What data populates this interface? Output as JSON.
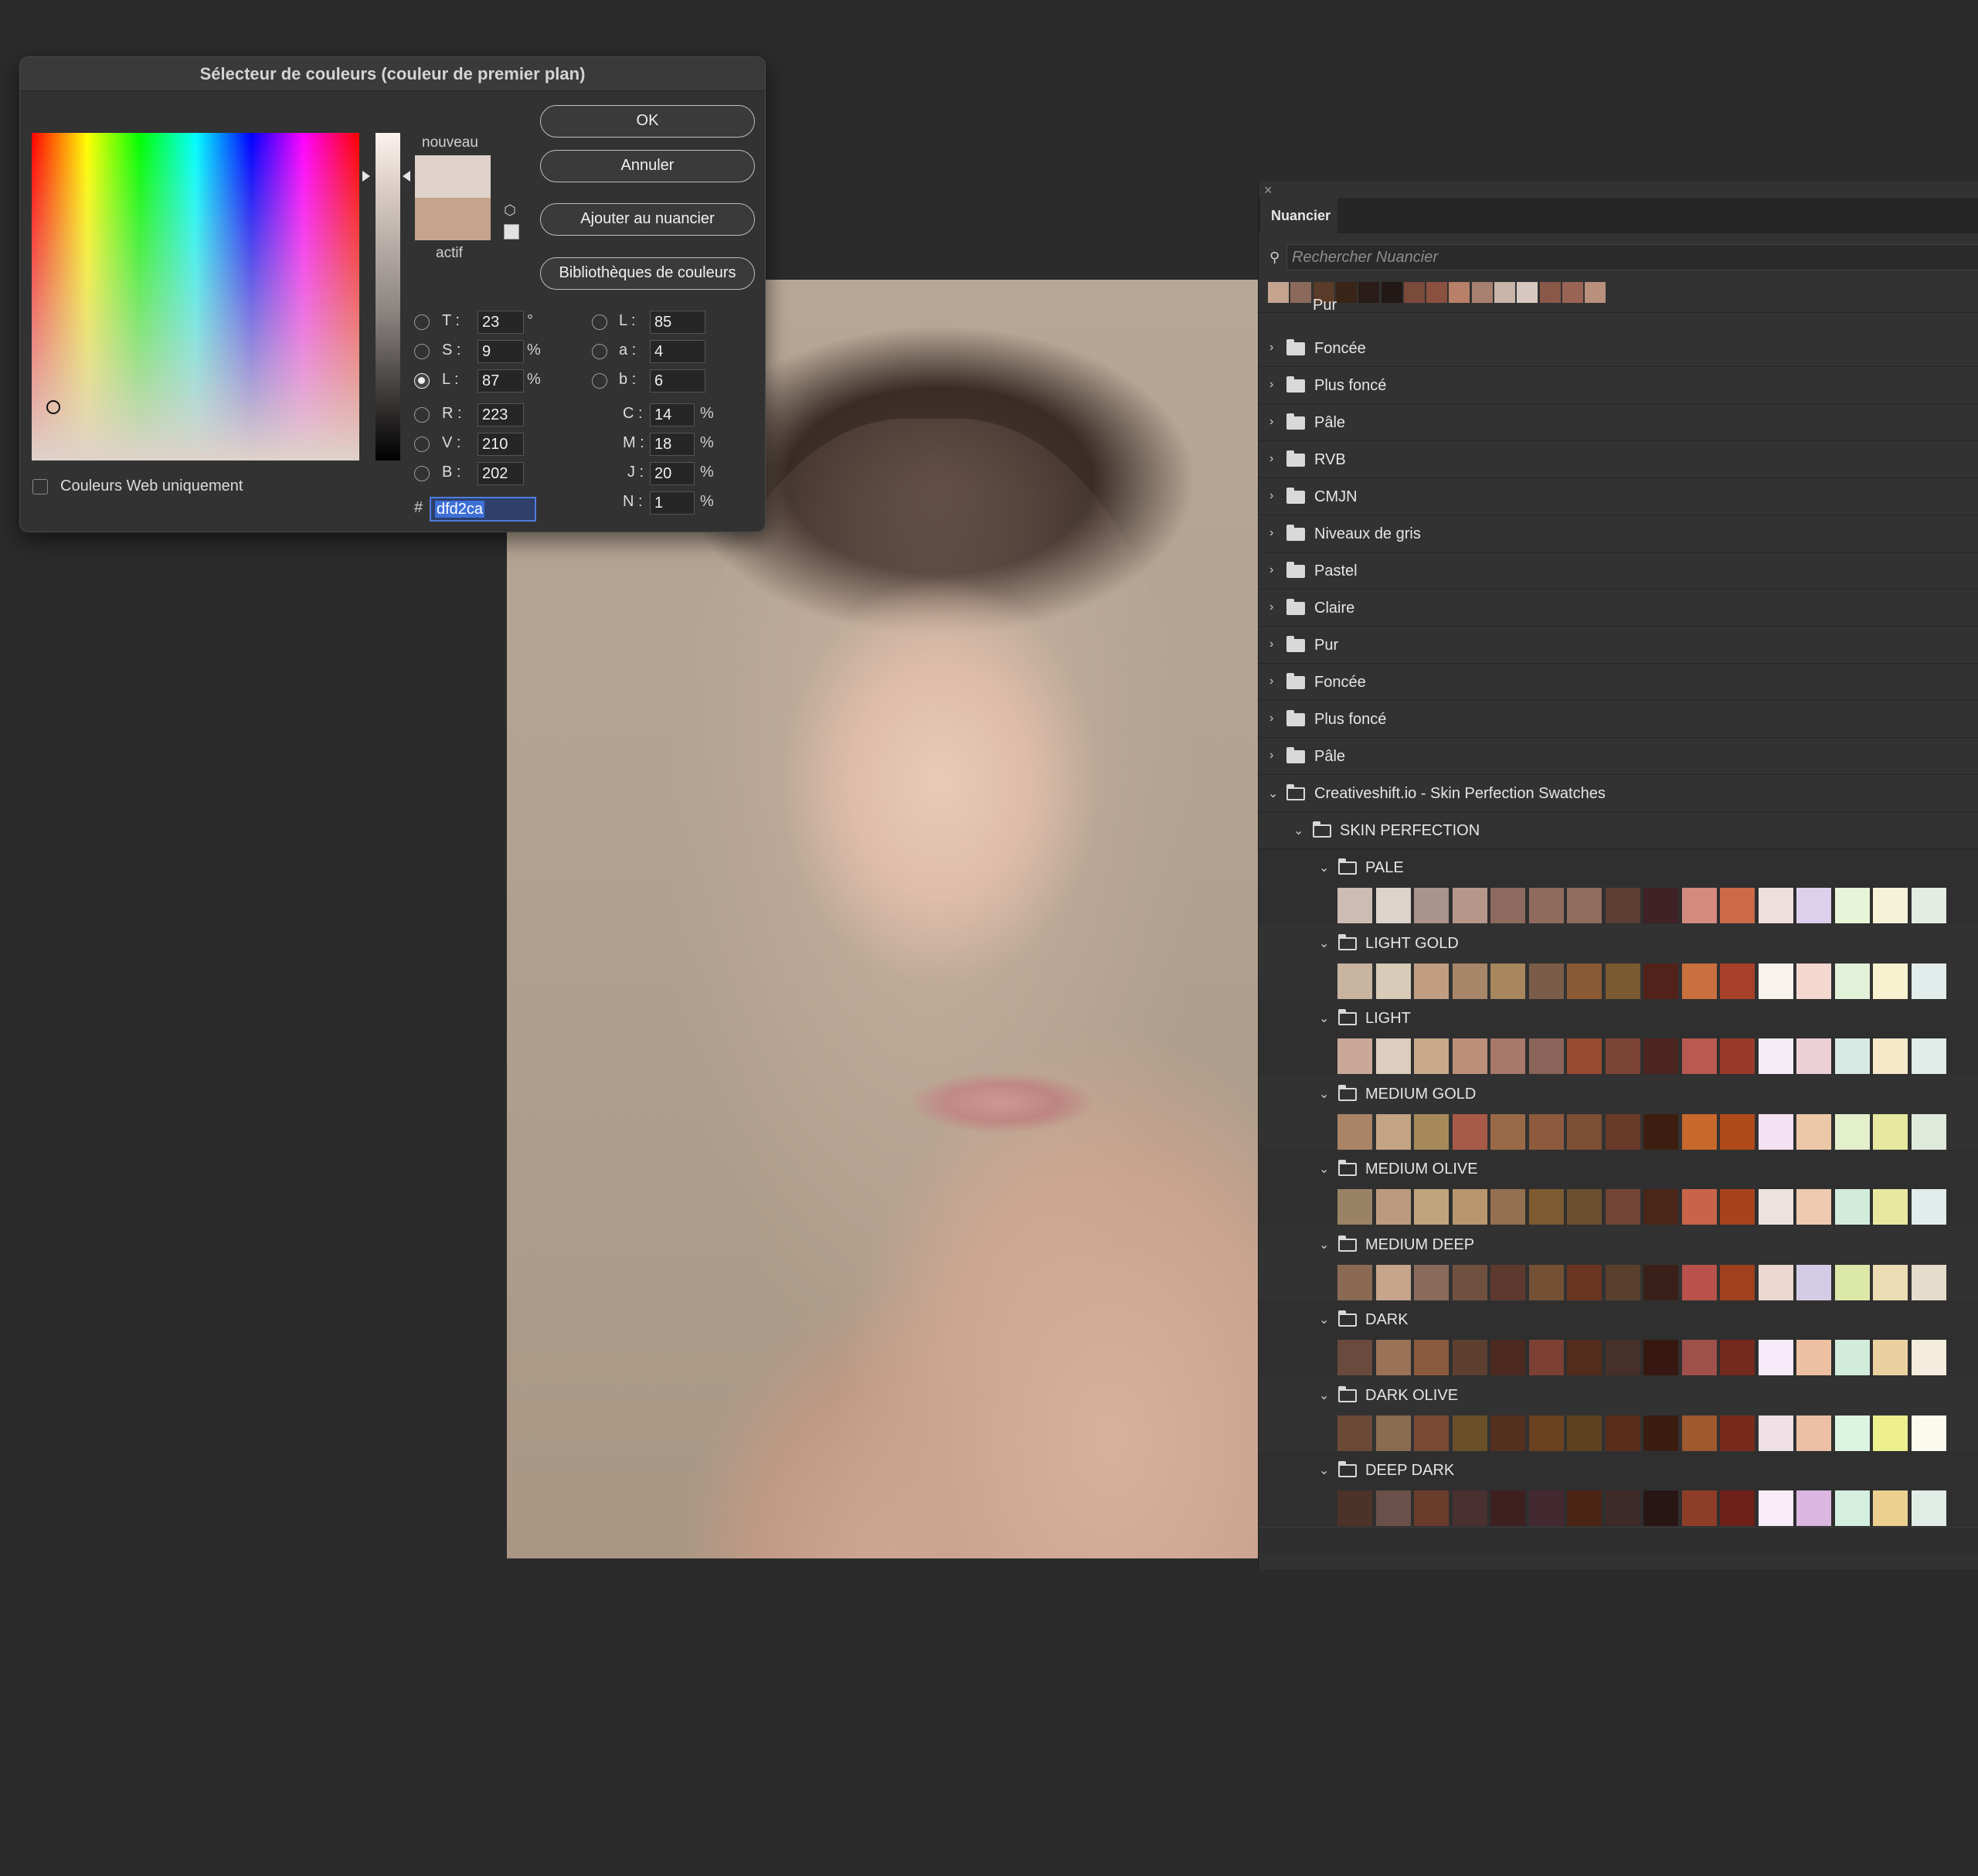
{
  "dialog": {
    "title": "Sélecteur de couleurs (couleur de premier plan)",
    "new_label": "nouveau",
    "current_label": "actif",
    "new_color": "#dfd2ca",
    "current_color": "#c4a48f",
    "buttons": {
      "ok": "OK",
      "cancel": "Annuler",
      "add_to_swatches": "Ajouter au nuancier",
      "color_libraries": "Bibliothèques de couleurs"
    },
    "web_colors_only": "Couleurs Web uniquement",
    "fields": {
      "H": {
        "label": "T :",
        "value": "23",
        "unit": "°"
      },
      "S": {
        "label": "S :",
        "value": "9",
        "unit": "%"
      },
      "Bv": {
        "label": "L :",
        "value": "87",
        "unit": "%"
      },
      "R": {
        "label": "R :",
        "value": "223"
      },
      "G": {
        "label": "V :",
        "value": "210"
      },
      "B": {
        "label": "B :",
        "value": "202"
      },
      "Lab_L": {
        "label": "L :",
        "value": "85"
      },
      "Lab_a": {
        "label": "a :",
        "value": "4"
      },
      "Lab_b": {
        "label": "b :",
        "value": "6"
      },
      "C": {
        "label": "C :",
        "value": "14",
        "unit": "%"
      },
      "M": {
        "label": "M :",
        "value": "18",
        "unit": "%"
      },
      "Y": {
        "label": "J :",
        "value": "20",
        "unit": "%"
      },
      "K": {
        "label": "N :",
        "value": "1",
        "unit": "%"
      },
      "hex_label": "#",
      "hex": "dfd2ca"
    },
    "selected_mode": "Bv"
  },
  "panel": {
    "close_glyph": "×",
    "tab": "Nuancier",
    "search_placeholder": "Rechercher Nuancier",
    "recent_colors": [
      "#c4a48f",
      "#8b6a5c",
      "#5a3a28",
      "#3a2418",
      "#2a1c18",
      "#221816",
      "#7a4a3a",
      "#8a5040",
      "#b88068",
      "#a88070",
      "#c8b4a8",
      "#d6c8c0",
      "#8a5848",
      "#9a6454",
      "#b8907c"
    ],
    "cut_item": "Pur",
    "folders": [
      "Foncée",
      "Plus foncé",
      "Pâle",
      "RVB",
      "CMJN",
      "Niveaux de gris",
      "Pastel",
      "Claire",
      "Pur",
      "Foncée",
      "Plus foncé",
      "Pâle"
    ],
    "library": "Creativeshift.io - Skin Perfection Swatches",
    "subfolder": "SKIN PERFECTION",
    "groups": [
      {
        "name": "PALE",
        "colors": [
          "#cdbcb3",
          "#dcd4ca",
          "#a9938a",
          "#b5978a",
          "#8c6a5e",
          "#8f6b5e",
          "#906c5e",
          "#5c3e33",
          "#3f2126",
          "#d58a80",
          "#cc6a48",
          "#ede0dc",
          "#ddd0ec",
          "#e8f4d8",
          "#f6f2d8",
          "#e4ece4"
        ]
      },
      {
        "name": "LIGHT GOLD",
        "colors": [
          "#c9b4a0",
          "#d8cbb8",
          "#c19e82",
          "#a88669",
          "#a8865e",
          "#7a5c48",
          "#8a5a34",
          "#7a5a30",
          "#52221a",
          "#c8703e",
          "#a8402a",
          "#f8f2ec",
          "#f4d8d0",
          "#e2f2d8",
          "#f8f2d0",
          "#e2ecea"
        ]
      },
      {
        "name": "LIGHT",
        "colors": [
          "#c9a89a",
          "#dccdbe",
          "#c8aa8a",
          "#bd907a",
          "#a8786a",
          "#8a6458",
          "#984a30",
          "#7c4434",
          "#4c2420",
          "#b85a52",
          "#9a3a2a",
          "#f6ecf8",
          "#ecd0d6",
          "#d8eae4",
          "#f6e8c8",
          "#e2ece8"
        ]
      },
      {
        "name": "MEDIUM GOLD",
        "colors": [
          "#a98466",
          "#c4a485",
          "#a88a5a",
          "#a85a48",
          "#9a6a48",
          "#8e5a3e",
          "#7c4e34",
          "#6a3a28",
          "#3e1e10",
          "#c8682c",
          "#b04a1a",
          "#f4e2f4",
          "#ecc8a8",
          "#e4f0cc",
          "#e8e8a0",
          "#e0eadc"
        ]
      },
      {
        "name": "MEDIUM OLIVE",
        "colors": [
          "#9a8266",
          "#bc9a80",
          "#c0a47c",
          "#b8966e",
          "#947050",
          "#7e5a30",
          "#6a5030",
          "#724436",
          "#4a2618",
          "#c8644a",
          "#a8421e",
          "#ede2e0",
          "#eecab0",
          "#d2ecdc",
          "#e8e8a0",
          "#e2ecea"
        ]
      },
      {
        "name": "MEDIUM DEEP",
        "colors": [
          "#8a6a52",
          "#c6a58c",
          "#8a6a5a",
          "#70503e",
          "#5e3a2e",
          "#745034",
          "#6a3420",
          "#5a3e2c",
          "#3a2018",
          "#b8524a",
          "#a0401e",
          "#ecd8d0",
          "#d4cce6",
          "#dce8a8",
          "#ecdcb4",
          "#e6dccc"
        ]
      },
      {
        "name": "DARK",
        "colors": [
          "#6a4a3c",
          "#9a7258",
          "#8a5a3e",
          "#5e4030",
          "#4c2a20",
          "#7c4034",
          "#542c1c",
          "#48302a",
          "#361810",
          "#a0504a",
          "#742a1c",
          "#f6eaf8",
          "#ecc0a0",
          "#d2ecdc",
          "#ead2a0",
          "#f4ecdc"
        ]
      },
      {
        "name": "DARK OLIVE",
        "colors": [
          "#6a4a36",
          "#8a6c50",
          "#7a4a36",
          "#6a5028",
          "#54301e",
          "#6a4220",
          "#5e4220",
          "#5a2e1a",
          "#3a1c10",
          "#a0582e",
          "#7a2a1a",
          "#eee0e4",
          "#ecc0a4",
          "#dcf4e2",
          "#eef090",
          "#fcfaec"
        ]
      },
      {
        "name": "DEEP DARK",
        "colors": [
          "#4c3228",
          "#6a5048",
          "#6a3c2c",
          "#4a3030",
          "#3e2020",
          "#442a30",
          "#4c2414",
          "#3e2a28",
          "#281614",
          "#8e3e28",
          "#6e2018",
          "#f8ecf8",
          "#dab6e0",
          "#d4eee0",
          "#ecd090",
          "#e2ece6"
        ]
      }
    ]
  }
}
